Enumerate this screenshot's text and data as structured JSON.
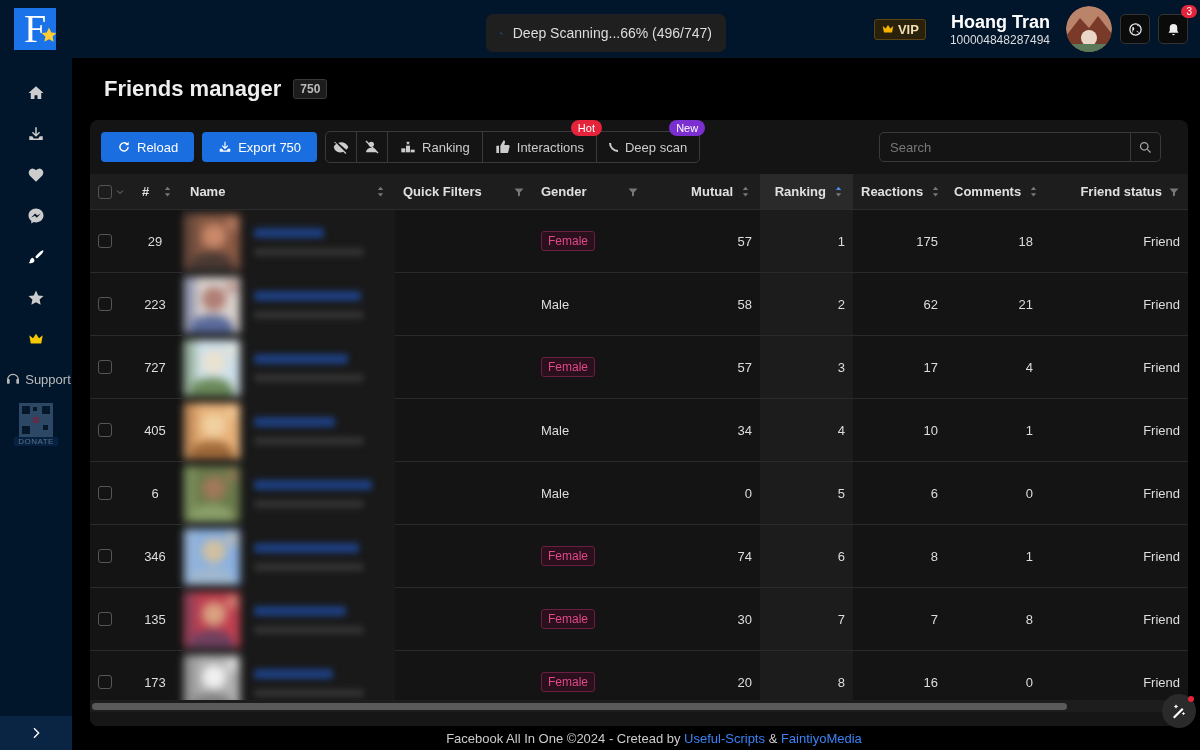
{
  "app": {
    "logo_letter": "F"
  },
  "scan_status": "Deep Scanning...66% (496/747)",
  "vip_badge": "VIP",
  "user": {
    "name": "Hoang Tran",
    "id": "100004848287494"
  },
  "notifications": {
    "count": "3"
  },
  "sidebar": {
    "items": [
      {
        "selected": false
      },
      {
        "selected": false
      },
      {
        "selected": false
      },
      {
        "selected": false
      },
      {
        "selected": false
      },
      {
        "selected": false
      },
      {
        "selected": false
      }
    ],
    "support": "Support",
    "donate": "DONATE"
  },
  "page": {
    "title": "Friends manager",
    "count": "750"
  },
  "toolbar": {
    "buttons": [
      "Reload",
      "Export 750"
    ],
    "segments": [
      {
        "kind": "icon"
      },
      {
        "kind": "icon"
      },
      {
        "kind": "text",
        "label": "Ranking"
      },
      {
        "kind": "text",
        "label": "Interactions",
        "badge": "Hot",
        "color": "#e5243b"
      },
      {
        "kind": "text",
        "label": "Deep scan",
        "badge": "New",
        "color": "#7b2fd1"
      }
    ]
  },
  "search": {
    "placeholder": "Search"
  },
  "table": {
    "select_all": {
      "checked": false
    },
    "columns": [
      {
        "label": "#",
        "kind": "sort",
        "sorted": false
      },
      {
        "label": "Name",
        "kind": "sort",
        "sorted": false
      },
      {
        "label": "Quick Filters",
        "kind": "filter"
      },
      {
        "label": "Gender",
        "kind": "filter"
      },
      {
        "label": "Mutual",
        "kind": "sort",
        "sorted": false
      },
      {
        "label": "Ranking",
        "kind": "sort",
        "sorted": true
      },
      {
        "label": "Reactions",
        "kind": "sort",
        "sorted": false
      },
      {
        "label": "Comments",
        "kind": "sort",
        "sorted": false
      },
      {
        "label": "Friend status",
        "kind": "filter"
      }
    ],
    "rows": [
      {
        "checked": false,
        "index": "29",
        "gender": "Female",
        "kind": "tag",
        "mutual": "57",
        "ranking": "1",
        "reactions": "175",
        "comments": "18",
        "status": "Friend"
      },
      {
        "checked": false,
        "index": "223",
        "gender": "Male",
        "kind": "plain",
        "mutual": "58",
        "ranking": "2",
        "reactions": "62",
        "comments": "21",
        "status": "Friend"
      },
      {
        "checked": false,
        "index": "727",
        "gender": "Female",
        "kind": "tag",
        "mutual": "57",
        "ranking": "3",
        "reactions": "17",
        "comments": "4",
        "status": "Friend"
      },
      {
        "checked": false,
        "index": "405",
        "gender": "Male",
        "kind": "plain",
        "mutual": "34",
        "ranking": "4",
        "reactions": "10",
        "comments": "1",
        "status": "Friend"
      },
      {
        "checked": false,
        "index": "6",
        "gender": "Male",
        "kind": "plain",
        "mutual": "0",
        "ranking": "5",
        "reactions": "6",
        "comments": "0",
        "status": "Friend"
      },
      {
        "checked": false,
        "index": "346",
        "gender": "Female",
        "kind": "tag",
        "mutual": "74",
        "ranking": "6",
        "reactions": "8",
        "comments": "1",
        "status": "Friend"
      },
      {
        "checked": false,
        "index": "135",
        "gender": "Female",
        "kind": "tag",
        "mutual": "30",
        "ranking": "7",
        "reactions": "7",
        "comments": "8",
        "status": "Friend"
      },
      {
        "checked": false,
        "index": "173",
        "gender": "Female",
        "kind": "tag",
        "mutual": "20",
        "ranking": "8",
        "reactions": "16",
        "comments": "0",
        "status": "Friend"
      }
    ]
  },
  "footer": {
    "text": "Facebook All In One ©2024 - Cretead by",
    "links": [
      "Useful-Scripts",
      "FaintiyoMedia"
    ],
    "joiner": "&"
  }
}
